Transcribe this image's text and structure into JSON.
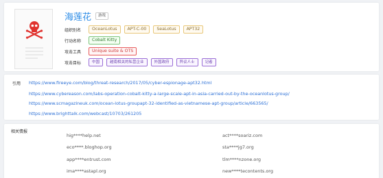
{
  "profile": {
    "title": "海莲花",
    "title_tag": "游戏",
    "icon": "skull-crossbones-document-icon",
    "aliases_label": "组织别名",
    "aliases": [
      "OceanLotus",
      "APT-C-00",
      "SeaLotus",
      "APT32"
    ],
    "actions_label": "行动名称",
    "actions": [
      "Cobalt Kitty"
    ],
    "tools_label": "攻击工具",
    "tools": [
      "Unique suite & OTS"
    ],
    "targets_label": "攻击目标",
    "targets": [
      "中国",
      "越南相关的私营企业",
      "外国政府",
      "异议人士",
      "记者"
    ]
  },
  "references": {
    "label": "引用",
    "links": [
      "https://www.fireeye.com/blog/threat-research/2017/05/cyber-espionage-apt32.html",
      "https://www.cybereason.com/labs-operation-cobalt-kitty-a-large-scale-apt-in-asia-carried-out-by-the-oceanlotus-group/",
      "https://www.scmagazineuk.com/ocean-lotus-groupapt-32-identified-as-vietnamese-apt-group/article/663565/",
      "https://www.brighttalk.com/webcast/10703/261205"
    ]
  },
  "intel": {
    "label": "相关情报",
    "left": [
      "hig****help.net",
      "eco****.bloghop.org",
      "app****entrust.com",
      "ima****astapl.org"
    ],
    "right": [
      "act****soariz.com",
      "sta****jg7.org",
      "tlm****nzone.org",
      "new****tecontents.org"
    ]
  },
  "colors": {
    "title_blue": "#2b8be6",
    "link_blue": "#2b6fd6",
    "skull_red": "#e0322e"
  }
}
